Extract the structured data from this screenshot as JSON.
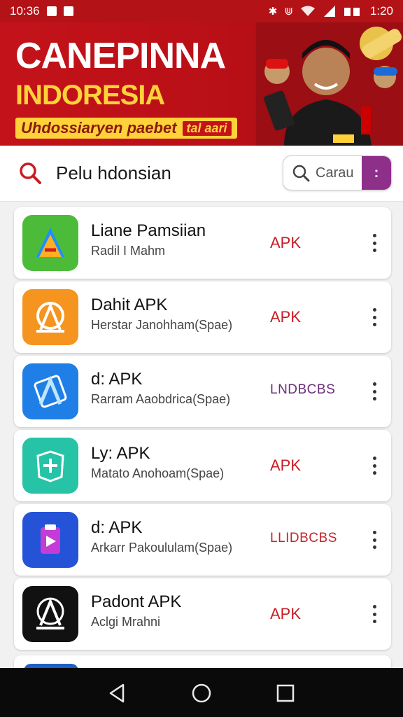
{
  "status_bar": {
    "time": "10:36",
    "clock_right": "1:20",
    "icons": [
      "photo-icon",
      "gallery-icon",
      "bluetooth-icon",
      "vibrate-icon",
      "wifi-icon",
      "signal-icon",
      "battery-icon"
    ]
  },
  "banner": {
    "title": "CANEPINNA",
    "subtitle": "INDORESIA",
    "tagline": "Uhdossiaryen paebet",
    "tag_chip": "tal aari"
  },
  "search": {
    "query": "Pelu hdonsian",
    "button_label": "Carau",
    "more_label": ":"
  },
  "apps": [
    {
      "name": "Liane Pamsiian",
      "subtitle": "Radil I Mahm",
      "badge": "APK",
      "badge_color": "#c81c24",
      "icon": "green-android-icon",
      "icon_bg": "#4cbb3a"
    },
    {
      "name": "Dahit APK",
      "subtitle": "Herstar Janohham(Spae)",
      "badge": "APK",
      "badge_color": "#c81c24",
      "icon": "orange-android-icon",
      "icon_bg": "#f5941e"
    },
    {
      "name": "d: APK",
      "subtitle": "Rarram Aaobdrica(Spae)",
      "badge": "LNDBCBS",
      "badge_color": "#6a2e7a",
      "icon": "blue-android-icon",
      "icon_bg": "#1f7fe6"
    },
    {
      "name": "Ly: APK",
      "subtitle": "Matato Anohoam(Spae)",
      "badge": "APK",
      "badge_color": "#c81c24",
      "icon": "teal-map-icon",
      "icon_bg": "#27c3a6"
    },
    {
      "name": "d: APK",
      "subtitle": "Arkarr Pakoululam(Spae)",
      "badge": "LLIDBCBS",
      "badge_color": "#c0282e",
      "icon": "purple-clipboard-icon",
      "icon_bg": "#2453d8"
    },
    {
      "name": "Padont APK",
      "subtitle": "Aclgi Mrahni",
      "badge": "APK",
      "badge_color": "#c81c24",
      "icon": "black-android-icon",
      "icon_bg": "#111111"
    }
  ],
  "nav": {
    "buttons": [
      "back-icon",
      "home-icon",
      "recents-icon"
    ]
  }
}
